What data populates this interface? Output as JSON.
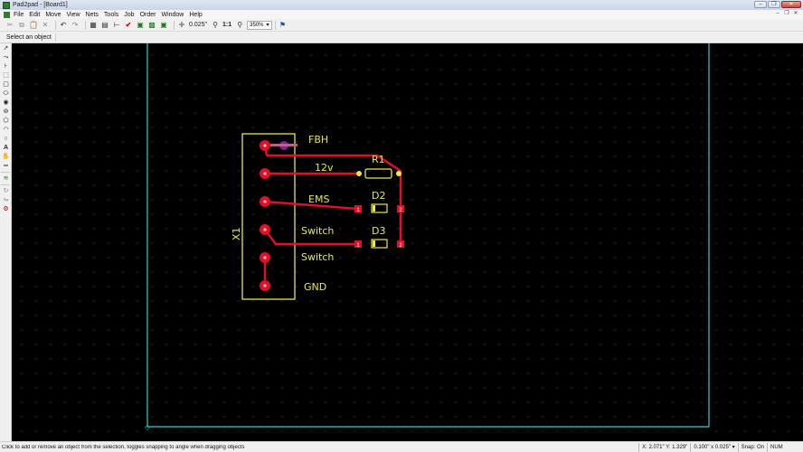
{
  "window": {
    "title": "Pad2pad - [Board1]"
  },
  "menu": {
    "items": [
      "File",
      "Edit",
      "Move",
      "View",
      "Nets",
      "Tools",
      "Job",
      "Order",
      "Window",
      "Help"
    ]
  },
  "toolbar": {
    "grid_value": "0.025\"",
    "zoom_label": "1:1",
    "zoom_value": "350%"
  },
  "hint": {
    "label": "Select an object"
  },
  "pcb": {
    "component_ref": "X1",
    "pin_labels": [
      "FBH",
      "12v",
      "EMS",
      "Switch",
      "Switch",
      "GND"
    ],
    "parts": [
      "R1",
      "D2",
      "D3"
    ],
    "pad_numbers": [
      "1",
      "2",
      "1",
      "2"
    ],
    "colors": {
      "trace": "#e0102a",
      "silkscreen": "#e8e84a",
      "board_outline": "#33cccc",
      "background": "#000000"
    }
  },
  "status": {
    "message": "Click to add or remove an object from the selection, toggles snapping to angle when dragging objects",
    "coords": "X: 2.071\" Y: 1.329\"",
    "grid": "0.100\" x 0.025\"",
    "snap": "Snap: On",
    "numlock": "NUM"
  }
}
